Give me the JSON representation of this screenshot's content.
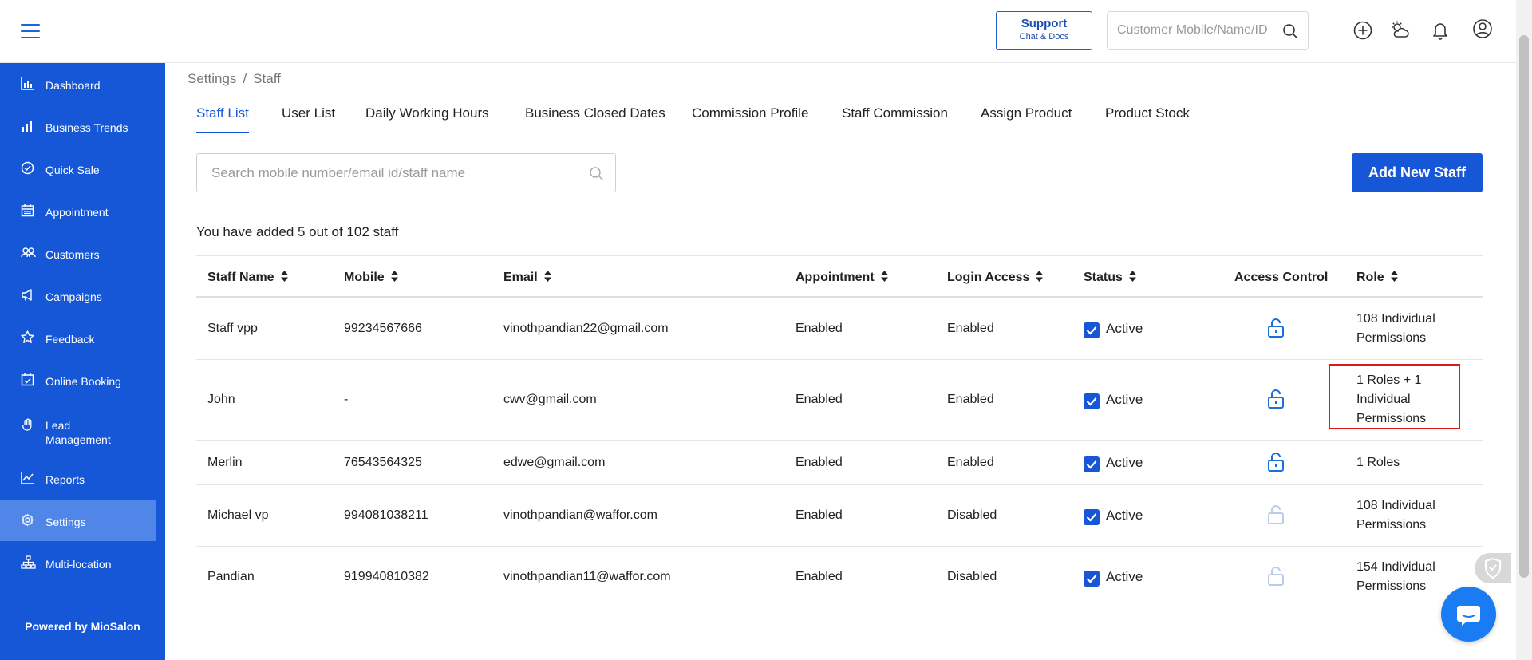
{
  "topbar": {
    "support_label": "Support",
    "support_sub": "Chat & Docs",
    "search_placeholder": "Customer Mobile/Name/ID"
  },
  "sidebar": {
    "items": [
      {
        "label": "Dashboard",
        "icon": "bar-chart-icon"
      },
      {
        "label": "Business Trends",
        "icon": "trend-bars-icon"
      },
      {
        "label": "Quick Sale",
        "icon": "check-circle-icon"
      },
      {
        "label": "Appointment",
        "icon": "calendar-icon"
      },
      {
        "label": "Customers",
        "icon": "users-icon"
      },
      {
        "label": "Campaigns",
        "icon": "megaphone-icon"
      },
      {
        "label": "Feedback",
        "icon": "star-icon"
      },
      {
        "label": "Online Booking",
        "icon": "calendar-check-icon"
      },
      {
        "label": "Lead",
        "label2": "Management",
        "icon": "hand-icon"
      },
      {
        "label": "Reports",
        "icon": "line-chart-icon"
      },
      {
        "label": "Settings",
        "icon": "gear-icon",
        "active": true
      },
      {
        "label": "Multi-location",
        "icon": "sitemap-icon"
      }
    ],
    "powered_by": "Powered by MioSalon"
  },
  "breadcrumb": {
    "root": "Settings",
    "separator": "/",
    "current": "Staff"
  },
  "tabs": [
    "Staff List",
    "User List",
    "Daily Working Hours",
    "Business Closed Dates",
    "Commission Profile",
    "Staff Commission",
    "Assign Product",
    "Product Stock"
  ],
  "active_tab": "Staff List",
  "staff_search": {
    "placeholder": "Search mobile number/email id/staff name"
  },
  "add_button": "Add New Staff",
  "count_text": "You have added 5 out of 102 staff",
  "table": {
    "headers": {
      "name": "Staff Name",
      "mobile": "Mobile",
      "email": "Email",
      "appointment": "Appointment",
      "login": "Login Access",
      "status": "Status",
      "access": "Access Control",
      "role": "Role"
    },
    "rows": [
      {
        "name": "Staff vpp",
        "mobile": "99234567666",
        "email": "vinothpandian22@gmail.com",
        "appointment": "Enabled",
        "login": "Enabled",
        "status": "Active",
        "role": "108 Individual Permissions",
        "lock_active": true
      },
      {
        "name": "John",
        "mobile": "-",
        "email": "cwv@gmail.com",
        "appointment": "Enabled",
        "login": "Enabled",
        "status": "Active",
        "role": "1 Roles + 1 Individual Permissions",
        "lock_active": true
      },
      {
        "name": "Merlin",
        "mobile": "76543564325",
        "email": "edwe@gmail.com",
        "appointment": "Enabled",
        "login": "Enabled",
        "status": "Active",
        "role": "1 Roles",
        "lock_active": true
      },
      {
        "name": "Michael vp",
        "mobile": "994081038211",
        "email": "vinothpandian@waffor.com",
        "appointment": "Enabled",
        "login": "Disabled",
        "status": "Active",
        "role": "108 Individual Permissions",
        "lock_active": false
      },
      {
        "name": "Pandian",
        "mobile": "919940810382",
        "email": "vinothpandian11@waffor.com",
        "appointment": "Enabled",
        "login": "Disabled",
        "status": "Active",
        "role": "154 Individual Permissions",
        "lock_active": false
      }
    ]
  },
  "colors": {
    "primary": "#1557d6",
    "sidebar_active": "#4f86e8",
    "highlight": "#e01818",
    "lock_active": "#1a6fd9",
    "lock_inactive": "#b9cde8"
  }
}
